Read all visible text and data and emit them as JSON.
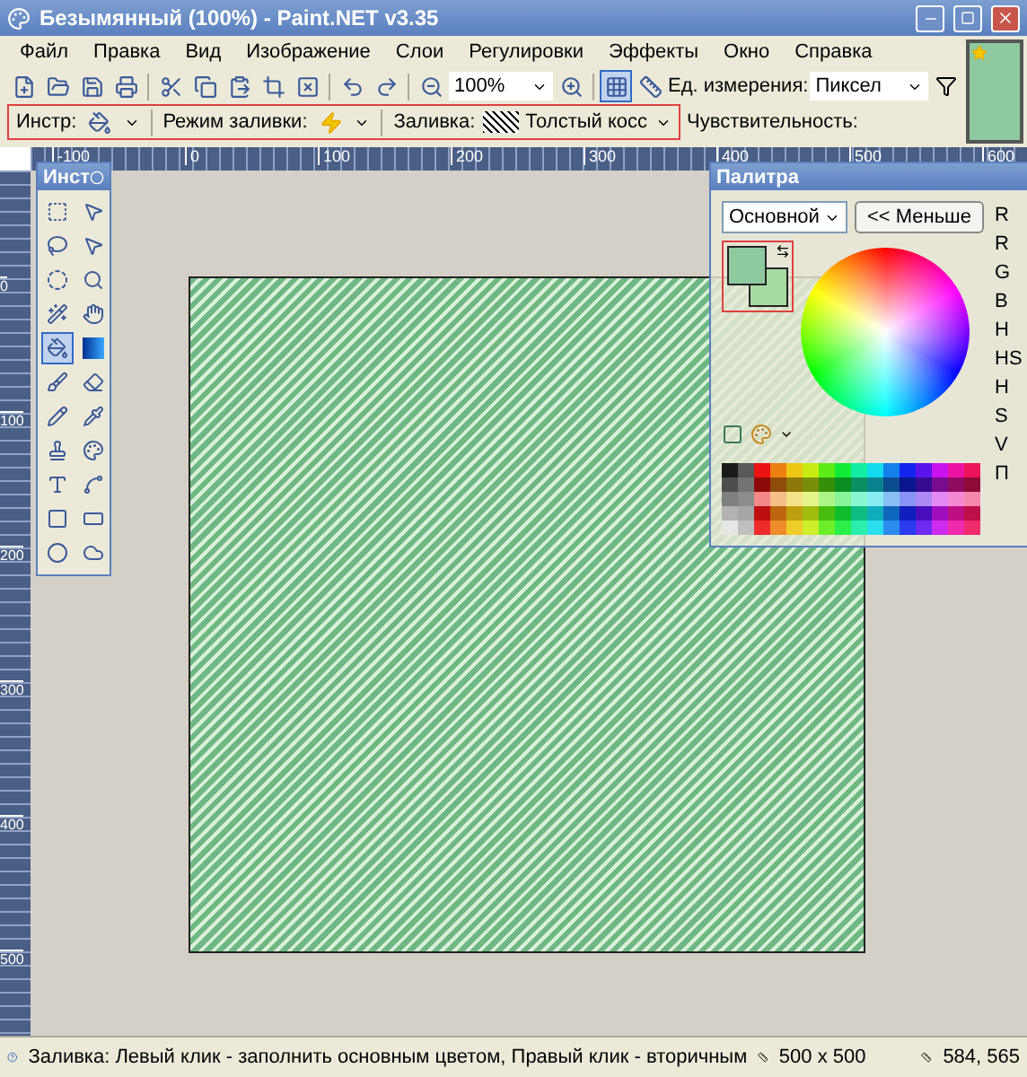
{
  "window": {
    "title": "Безымянный (100%) - Paint.NET v3.35"
  },
  "menu": [
    "Файл",
    "Правка",
    "Вид",
    "Изображение",
    "Слои",
    "Регулировки",
    "Эффекты",
    "Окно",
    "Справка"
  ],
  "toolbar": {
    "zoom": "100%",
    "units_label": "Ед. измерения:",
    "units": "Пиксел",
    "grid_on": true
  },
  "tool_options": {
    "tool_label": "Инстр:",
    "fill_mode_label": "Режим заливки:",
    "fill_label": "Заливка:",
    "fill": "Толстый косс",
    "sensitivity_label": "Чувствительность:"
  },
  "rulers": {
    "horizontal": [
      "-100",
      "0",
      "100",
      "200",
      "300",
      "400",
      "500",
      "600"
    ],
    "vertical": [
      "0",
      "100",
      "200",
      "300",
      "400",
      "500"
    ]
  },
  "tools_window": {
    "title": "Инст",
    "tools": [
      {
        "selected": false
      },
      {
        "selected": false
      },
      {
        "selected": false
      },
      {
        "selected": false
      },
      {
        "selected": false
      },
      {
        "selected": false
      },
      {
        "selected": false
      },
      {
        "selected": false
      },
      {
        "selected": true
      },
      {
        "selected": false
      },
      {
        "selected": false
      },
      {
        "selected": false
      },
      {
        "selected": false
      },
      {
        "selected": false
      },
      {
        "selected": false
      },
      {
        "selected": false
      },
      {
        "selected": false
      },
      {
        "selected": false
      },
      {
        "selected": false
      },
      {
        "selected": false
      },
      {
        "selected": false
      },
      {
        "selected": false
      }
    ]
  },
  "palette": {
    "title": "Палитра",
    "mode": "Основной",
    "less_button": "<< Меньше",
    "labels": [
      "R",
      "R",
      "G",
      "B",
      "H",
      "HS",
      "H",
      "S",
      "V",
      "П"
    ]
  },
  "status": {
    "hint": "Заливка: Левый клик - заполнить основным цветом, Правый клик - вторичным",
    "size": "500 x 500",
    "cursor": "584, 565"
  }
}
